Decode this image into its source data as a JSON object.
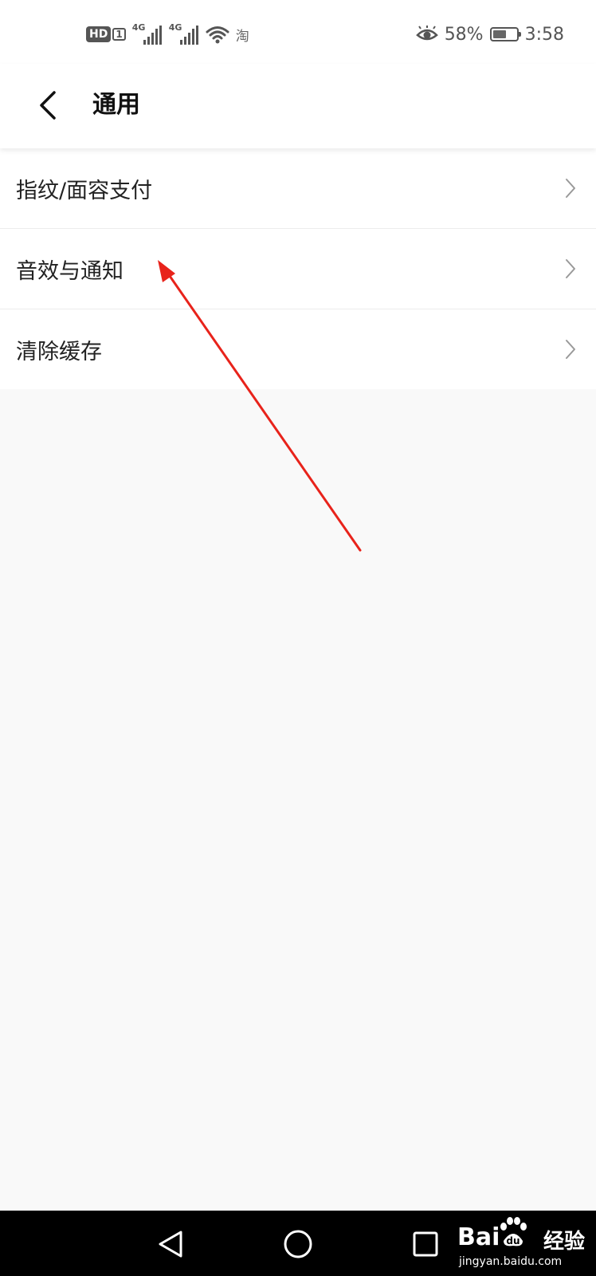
{
  "status_bar": {
    "hd_label": "HD",
    "sim_label": "1",
    "network_1": "4G",
    "network_2": "4G",
    "taobao_icon_text": "淘",
    "battery_percent": "58%",
    "battery_level": 0.58,
    "time": "3:58"
  },
  "header": {
    "title": "通用"
  },
  "settings": {
    "items": [
      {
        "label": "指纹/面容支付"
      },
      {
        "label": "音效与通知"
      },
      {
        "label": "清除缓存"
      }
    ]
  },
  "watermark": {
    "brand_left": "Bai",
    "brand_right": "du",
    "suffix": "经验",
    "url": "jingyan.baidu.com"
  },
  "colors": {
    "annotation_arrow": "#e8231b",
    "page_background": "#f9f9f9",
    "nav_bar": "#000000"
  }
}
